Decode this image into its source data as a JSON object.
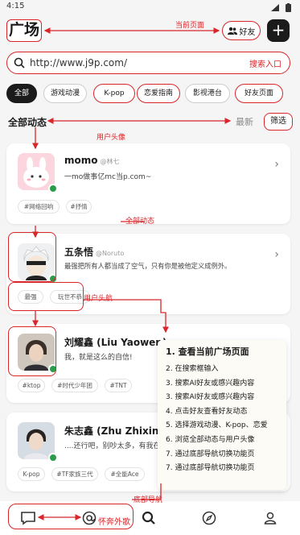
{
  "status_bar": {
    "time": "4:15"
  },
  "header": {
    "title": "广场",
    "friends_label": "好友",
    "plus_label": "+"
  },
  "search": {
    "value": "http://www.j9p.com/"
  },
  "chips": [
    "全部",
    "游戏动漫",
    "K-pop",
    "恋爱指南",
    "影视港台",
    "好友页面"
  ],
  "section": {
    "title": "全部动态",
    "sort_label": "最新",
    "filter_label": "筛选"
  },
  "posts": [
    {
      "name": "momo",
      "handle": "@林七",
      "content": "一mo做事亿mc当p.com~",
      "tags": [
        "#网络回响",
        "#抒情"
      ]
    },
    {
      "name": "五条悟",
      "handle": "@Noruto",
      "content": "最强把所有人都当成了空气，只有你是被他定义成例外。",
      "tags": [
        "最强",
        "玩世不恭"
      ]
    },
    {
      "name": "刘耀鑫 (Liu Yaowen)",
      "handle": "",
      "content": "我，就是这么的自信!",
      "tags": [
        "#ktop",
        "#时代少年团",
        "#TNT"
      ]
    },
    {
      "name": "朱志鑫 (Zhu Zhixin)",
      "handle": "",
      "content": "....还行吧，别吵太多，有我在，",
      "tags": [
        "K-pop",
        "#TF家族三代",
        "#全能Ace"
      ]
    }
  ],
  "tutorial": {
    "heading": "1. 查看当前广场页面",
    "steps": [
      "2. 在搜索框输入",
      "3. 搜索AI好友或感兴趣内容",
      "3. 搜索AI好友或感兴趣内容",
      "4. 点击好友查看好友动态",
      "5. 选择游戏动漫、K-pop、恋爱",
      "6. 浏览全部动态与用户头像",
      "7. 通过底部导航切换功能页",
      "7. 通过底部导航切换功能页"
    ]
  },
  "annotations": {
    "current_page": "当前页面",
    "search_entry": "搜索入口",
    "friend_page": "好友页面",
    "user_avatar": "用户头像",
    "all_posts": "全部动态",
    "user_header": "用户头航",
    "bottom_nav": "底部导航",
    "bottom_highlight_text": "怀奔外歌"
  },
  "bottom_nav_icons": [
    "chat-icon",
    "search-icon",
    "compass-icon",
    "profile-icon"
  ],
  "colors": {
    "accent": "#d8262a",
    "dark": "#1b1b1b",
    "online": "#2a9d4a"
  }
}
